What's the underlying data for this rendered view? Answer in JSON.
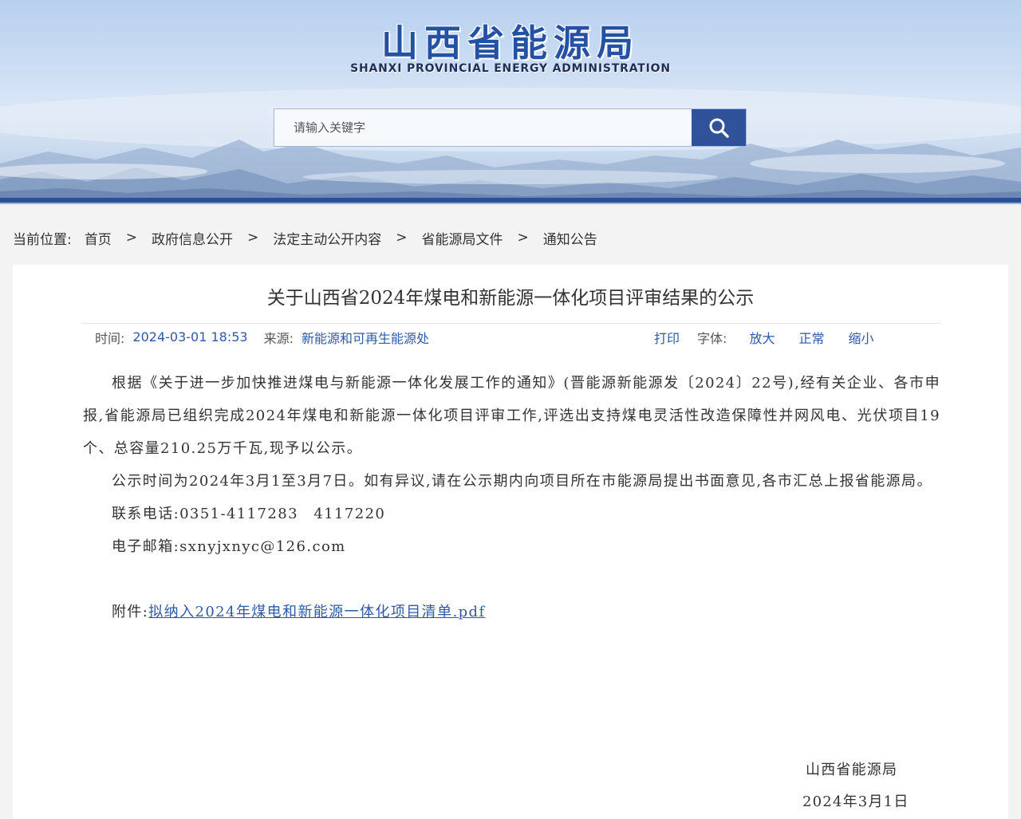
{
  "header": {
    "logo_title": "山西省能源局",
    "logo_subtitle": "SHANXI PROVINCIAL ENERGY ADMINISTRATION",
    "search_placeholder": "请输入关键字"
  },
  "breadcrumb": {
    "label": "当前位置:",
    "items": [
      "首页",
      "政府信息公开",
      "法定主动公开内容",
      "省能源局文件",
      "通知公告"
    ],
    "separator": ">"
  },
  "article": {
    "title": "关于山西省2024年煤电和新能源一体化项目评审结果的公示",
    "meta": {
      "time_label": "时间:",
      "time": "2024-03-01 18:53",
      "source_label": "来源:",
      "source": "新能源和可再生能源处",
      "print": "打印",
      "font_label": "字体:",
      "font_large": "放大",
      "font_normal": "正常",
      "font_small": "缩小"
    },
    "paragraphs": [
      "根据《关于进一步加快推进煤电与新能源一体化发展工作的通知》(晋能源新能源发〔2024〕22号),经有关企业、各市申报,省能源局已组织完成2024年煤电和新能源一体化项目评审工作,评选出支持煤电灵活性改造保障性并网风电、光伏项目19个、总容量210.25万千瓦,现予以公示。",
      "公示时间为2024年3月1至3月7日。如有异议,请在公示期内向项目所在市能源局提出书面意见,各市汇总上报省能源局。",
      "联系电话:0351-4117283　4117220",
      "电子邮箱:sxnyjxnyc@126.com"
    ],
    "attachment_label": "附件:",
    "attachment_link": "拟纳入2024年煤电和新能源一体化项目清单.pdf",
    "signature_org": "山西省能源局",
    "signature_date": "2024年3月1日"
  },
  "colors": {
    "brand_blue": "#2f529b",
    "link_blue": "#2e5aa7",
    "title_blue": "#2551a5"
  }
}
